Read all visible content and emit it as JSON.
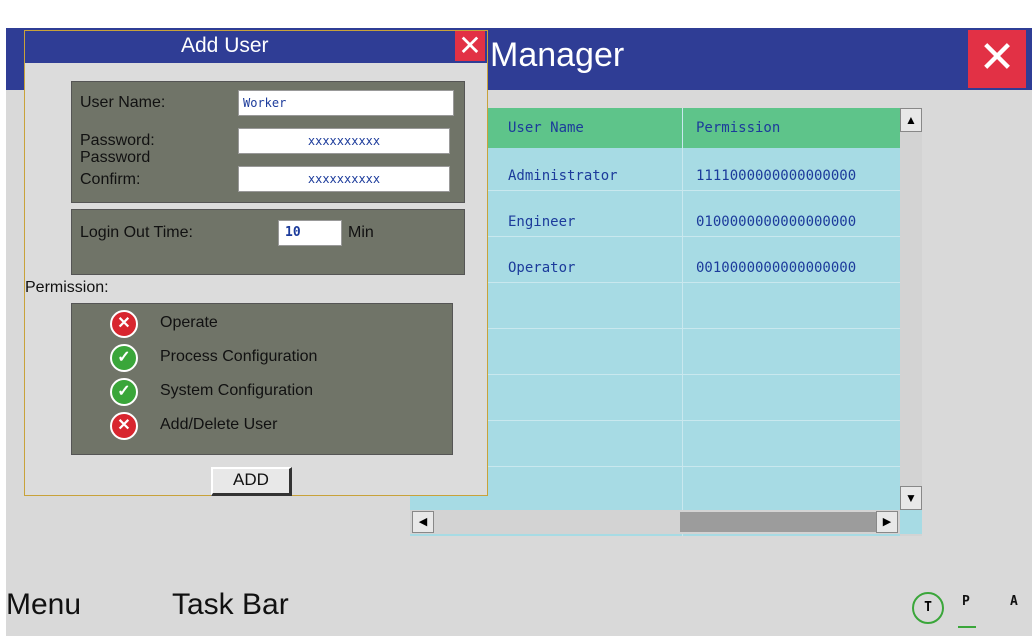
{
  "manager": {
    "title": "Manager",
    "close_label": "✕",
    "columns": [
      "User Name",
      "Permission"
    ],
    "rows": [
      {
        "name": "Administrator",
        "permission": "1111000000000000000"
      },
      {
        "name": "Engineer",
        "permission": "0100000000000000000"
      },
      {
        "name": "Operator",
        "permission": "0010000000000000000"
      }
    ]
  },
  "dialog": {
    "title": "Add User",
    "close_label": "✕",
    "user_name_label": "User Name:",
    "user_name_value": "Worker",
    "password_label": "Password:",
    "password_value": "xxxxxxxxxx",
    "confirm_label_1": "Password",
    "confirm_label_2": "Confirm:",
    "confirm_value": "xxxxxxxxxx",
    "logout_label": "Login Out Time:",
    "logout_value": "10",
    "logout_unit": "Min",
    "permission_label": "Permission:",
    "permissions": [
      {
        "label": "Operate",
        "enabled": false
      },
      {
        "label": "Process Configuration",
        "enabled": true
      },
      {
        "label": "System Configuration",
        "enabled": true
      },
      {
        "label": "Add/Delete User",
        "enabled": false
      }
    ],
    "add_label": "ADD"
  },
  "taskbar": {
    "menu_label": "Menu",
    "taskbar_label": "Task Bar",
    "modes": [
      "T",
      "P",
      "A"
    ]
  },
  "colors": {
    "title_bar": "#2f3d95",
    "close": "#e23145",
    "grid": "#a7dbe4",
    "grid_header": "#5ec48a"
  }
}
